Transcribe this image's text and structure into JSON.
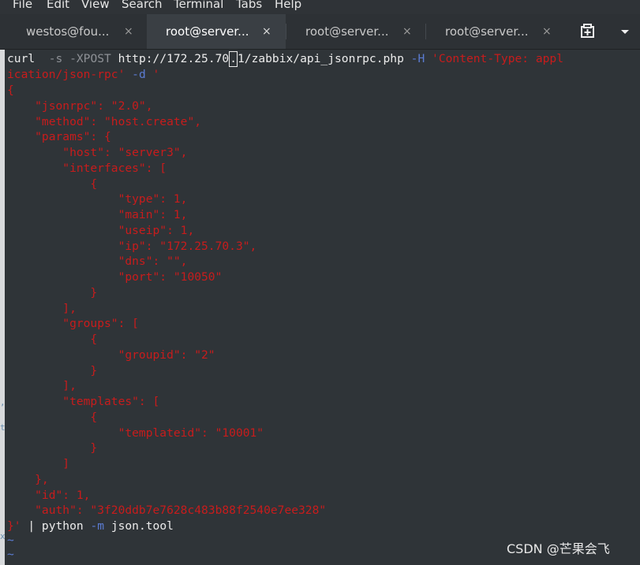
{
  "menubar": {
    "items": [
      "File",
      "Edit",
      "View",
      "Search",
      "Terminal",
      "Tabs",
      "Help"
    ]
  },
  "tabs": [
    {
      "label": "westos@fou...",
      "close": "×",
      "active": false
    },
    {
      "label": "root@server...",
      "close": "×",
      "active": true
    },
    {
      "label": "root@server...",
      "close": "×",
      "active": false
    },
    {
      "label": "root@server...",
      "close": "×",
      "active": false
    }
  ],
  "toolbar": {
    "new_tab_icon": "new-tab-icon",
    "menu_icon": "chevron-down-icon"
  },
  "colors": {
    "menubar_bg": "#2f3337",
    "terminal_bg": "#2f3438",
    "text": "#ececec",
    "string": "#c81c1c",
    "option": "#5b7cd3"
  },
  "terminal": {
    "command": {
      "prefix": "curl",
      "flags1": "-s -XPOST",
      "url_before_cursor": "http://172.25.70",
      "cursor_char": ".",
      "url_after_cursor": "1/zabbix/api_jsonrpc.php",
      "flag_h": "-H",
      "header_part1": "'Content-Type: appl",
      "header_part2": "ication/json-rpc'",
      "flag_d": "-d",
      "quote_open": "'"
    },
    "json_lines": [
      "{",
      "    \"jsonrpc\": \"2.0\",",
      "    \"method\": \"host.create\",",
      "    \"params\": {",
      "        \"host\": \"server3\",",
      "        \"interfaces\": [",
      "            {",
      "                \"type\": 1,",
      "                \"main\": 1,",
      "                \"useip\": 1,",
      "                \"ip\": \"172.25.70.3\",",
      "                \"dns\": \"\",",
      "                \"port\": \"10050\"",
      "            }",
      "        ],",
      "        \"groups\": [",
      "            {",
      "                \"groupid\": \"2\"",
      "            }",
      "        ],",
      "        \"templates\": [",
      "            {",
      "                \"templateid\": \"10001\"",
      "            }",
      "        ]",
      "    },",
      "    \"id\": 1,",
      "    \"auth\": \"3f20ddb7e7628c483b88f2540e7ee328\""
    ],
    "closing": {
      "quote_close": "}'",
      "pipe": " | python ",
      "flag_m": "-m",
      "module": " json.tool"
    },
    "tildes": [
      "~",
      "~"
    ]
  },
  "watermark": "CSDN @芒果会飞"
}
